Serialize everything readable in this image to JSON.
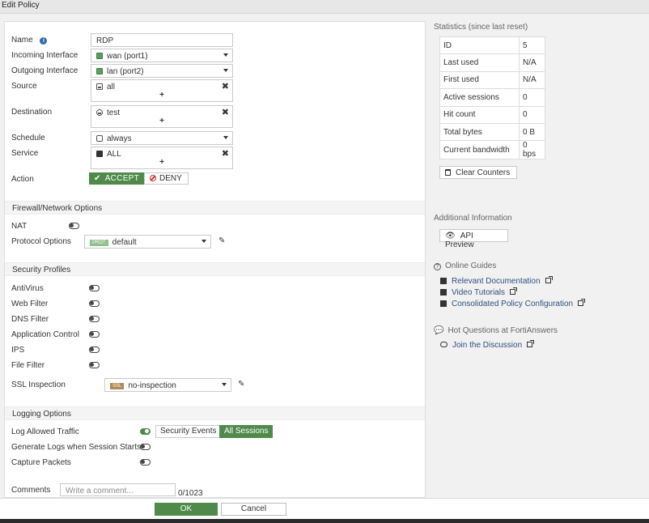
{
  "header": {
    "title": "Edit Policy"
  },
  "form": {
    "name": {
      "label": "Name",
      "value": "RDP"
    },
    "incoming": {
      "label": "Incoming Interface",
      "value": "wan (port1)"
    },
    "outgoing": {
      "label": "Outgoing Interface",
      "value": "lan (port2)"
    },
    "source": {
      "label": "Source",
      "value": "all"
    },
    "destination": {
      "label": "Destination",
      "value": "test"
    },
    "schedule": {
      "label": "Schedule",
      "value": "always"
    },
    "service": {
      "label": "Service",
      "value": "ALL"
    },
    "action": {
      "label": "Action",
      "accept": "ACCEPT",
      "deny": "DENY",
      "selected": "ACCEPT"
    }
  },
  "firewall": {
    "title": "Firewall/Network Options",
    "nat": {
      "label": "NAT",
      "on": false
    },
    "protocol": {
      "label": "Protocol Options",
      "badge": "PROT",
      "value": "default"
    }
  },
  "security": {
    "title": "Security Profiles",
    "items": [
      {
        "label": "AntiVirus",
        "on": false
      },
      {
        "label": "Web Filter",
        "on": false
      },
      {
        "label": "DNS Filter",
        "on": false
      },
      {
        "label": "Application Control",
        "on": false
      },
      {
        "label": "IPS",
        "on": false
      },
      {
        "label": "File Filter",
        "on": false
      }
    ],
    "ssl": {
      "label": "SSL Inspection",
      "badge": "SSL",
      "value": "no-inspection"
    }
  },
  "logging": {
    "title": "Logging Options",
    "allowed": {
      "label": "Log Allowed Traffic",
      "on": true,
      "opt1": "Security Events",
      "opt2": "All Sessions",
      "selected": "All Sessions"
    },
    "session_start": {
      "label": "Generate Logs when Session Starts",
      "on": false
    },
    "capture": {
      "label": "Capture Packets",
      "on": false
    }
  },
  "comments": {
    "label": "Comments",
    "placeholder": "Write a comment...",
    "count": "0/1023"
  },
  "stats": {
    "title": "Statistics (since last reset)",
    "rows": [
      {
        "k": "ID",
        "v": "5"
      },
      {
        "k": "Last used",
        "v": "N/A"
      },
      {
        "k": "First used",
        "v": "N/A"
      },
      {
        "k": "Active sessions",
        "v": "0"
      },
      {
        "k": "Hit count",
        "v": "0"
      },
      {
        "k": "Total bytes",
        "v": "0 B"
      },
      {
        "k": "Current bandwidth",
        "v": "0 bps"
      }
    ],
    "clear": "Clear Counters"
  },
  "additional": {
    "title": "Additional Information",
    "api": "API Preview"
  },
  "guides": {
    "title": "Online Guides",
    "links": [
      "Relevant Documentation",
      "Video Tutorials",
      "Consolidated Policy Configuration"
    ]
  },
  "hot": {
    "title": "Hot Questions at FortiAnswers",
    "link": "Join the Discussion"
  },
  "footer": {
    "ok": "OK",
    "cancel": "Cancel"
  },
  "colors": {
    "accent": "#4f8a4b",
    "deny": "#d03030",
    "link": "#2f4f7f",
    "prot_badge": "#8fbf8a",
    "ssl_badge": "#b08a52"
  }
}
